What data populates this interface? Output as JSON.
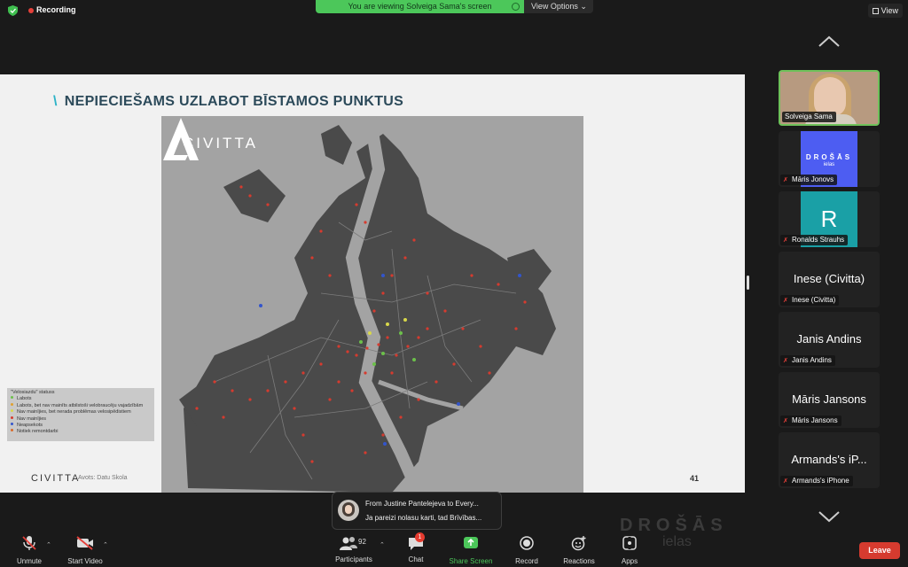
{
  "topbar": {
    "recording_label": "Recording",
    "viewing_banner": "You are viewing Solveiga Sama's screen",
    "view_options_label": "View Options",
    "view_button_label": "View"
  },
  "slide": {
    "title": "NEPIECIEŠAMS UZLABOT BĪSTAMOS PUNKTUS",
    "map_brand": "CIVITTA",
    "legend": {
      "title": "\"Velosiazdu\" statuss",
      "items": [
        {
          "label": "Labots",
          "color": "#6cc04a"
        },
        {
          "label": "Labots, bet nav mainīts atbilstoši velobraucēju vajadzībām",
          "color": "#e0a030"
        },
        {
          "label": "Nav mainījies, bet nerada problēmas velosipēdistiem",
          "color": "#d8d84a"
        },
        {
          "label": "Nav mainījies",
          "color": "#d63b2f"
        },
        {
          "label": "Neapsekots",
          "color": "#3355cc"
        },
        {
          "label": "Notiek remontdarbi",
          "color": "#d96a2a"
        }
      ]
    },
    "footer_brand": "CIVITTA",
    "footer_source": "Avots: Datu Skola",
    "page_number": "41"
  },
  "participants_panel": {
    "tiles": [
      {
        "name": "Solveiga Sama",
        "type": "video"
      },
      {
        "name": "Māris Jonovs",
        "type": "logo",
        "logo_line1": "DROŠĀS",
        "logo_line2": "ielas"
      },
      {
        "name": "Ronalds Strauhs",
        "type": "initial",
        "initial": "R"
      },
      {
        "name": "Inese (Civitta)",
        "type": "text",
        "display": "Inese (Civitta)"
      },
      {
        "name": "Janis Andins",
        "type": "text",
        "display": "Janis Andins"
      },
      {
        "name": "Māris Jansons",
        "type": "text",
        "display": "Māris Jansons"
      },
      {
        "name": "Armands's iPhone",
        "type": "text",
        "display": "Armands's iP..."
      }
    ]
  },
  "toolbar": {
    "unmute_label": "Unmute",
    "start_video_label": "Start Video",
    "participants_label": "Participants",
    "participants_count": "92",
    "chat_label": "Chat",
    "chat_badge": "1",
    "share_screen_label": "Share Screen",
    "record_label": "Record",
    "reactions_label": "Reactions",
    "apps_label": "Apps",
    "leave_label": "Leave"
  },
  "chat_toast": {
    "from": "From Justine Pantelejeva to Every...",
    "message": "Ja pareizi nolasu karti, tad Brīvības..."
  },
  "watermark": {
    "line1": "DROŠĀS",
    "line2": "ielas"
  },
  "colors": {
    "accent_green": "#4cc75a",
    "leave_red": "#d63b2f",
    "share_green": "#4cc75a"
  }
}
